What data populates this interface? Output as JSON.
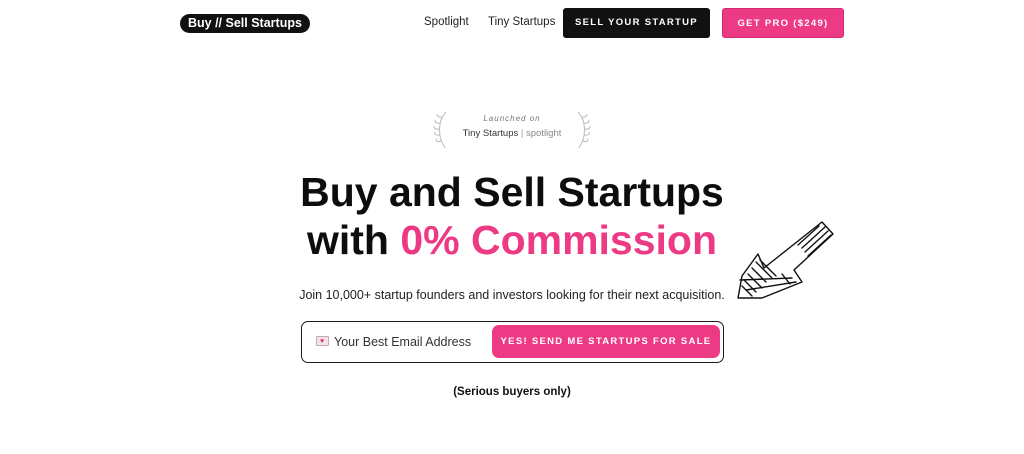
{
  "nav": {
    "logo": "Buy // Sell Startups",
    "links": [
      "Spotlight",
      "Tiny Startups"
    ],
    "sell_button": "SELL YOUR STARTUP",
    "pro_button": "GET PRO ($249)"
  },
  "badge": {
    "top": "Launched on",
    "brand": "Tiny Startups",
    "separator": "|",
    "suffix": "spotlight"
  },
  "hero": {
    "line1": "Buy and Sell Startups",
    "line2_prefix": "with ",
    "line2_accent": "0% Commission",
    "subtitle": "Join 10,000+ startup founders and investors looking for their next acquisition."
  },
  "form": {
    "email_icon": "love-letter-icon",
    "email_placeholder": "Your Best Email Address",
    "submit_label": "YES! SEND ME STARTUPS FOR SALE"
  },
  "note": "(Serious buyers only)",
  "colors": {
    "accent": "#ec3a84",
    "dark": "#111111"
  }
}
